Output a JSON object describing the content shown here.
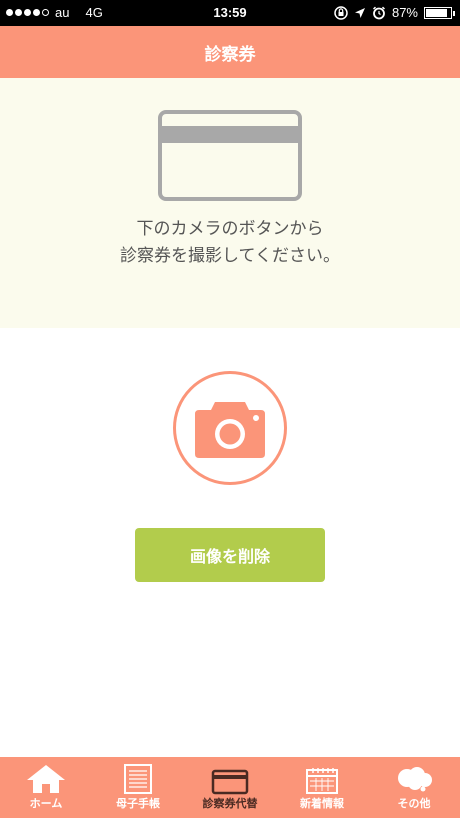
{
  "status_bar": {
    "carrier": "au",
    "network": "4G",
    "time": "13:59",
    "battery": "87%",
    "battery_level": 0.87,
    "icons": [
      "rotation-lock-icon",
      "location-arrow-icon",
      "alarm-icon"
    ]
  },
  "header": {
    "title": "診察券"
  },
  "instructions": {
    "line1": "下のカメラのボタンから",
    "line2": "診察券を撮影してください。"
  },
  "camera_button": {
    "icon": "camera-icon"
  },
  "delete_button": {
    "label": "画像を削除"
  },
  "colors": {
    "accent": "#fb9579",
    "panel_bg": "#fbfbed",
    "button_green": "#b2cc4c",
    "active_tab": "#4a2a22"
  },
  "tabs": [
    {
      "label": "ホーム",
      "icon": "home-icon"
    },
    {
      "label": "母子手帳",
      "icon": "notebook-icon"
    },
    {
      "label": "診察券代替",
      "icon": "card-icon",
      "active": true
    },
    {
      "label": "新着情報",
      "icon": "calendar-icon"
    },
    {
      "label": "その他",
      "icon": "cloud-icon"
    }
  ]
}
